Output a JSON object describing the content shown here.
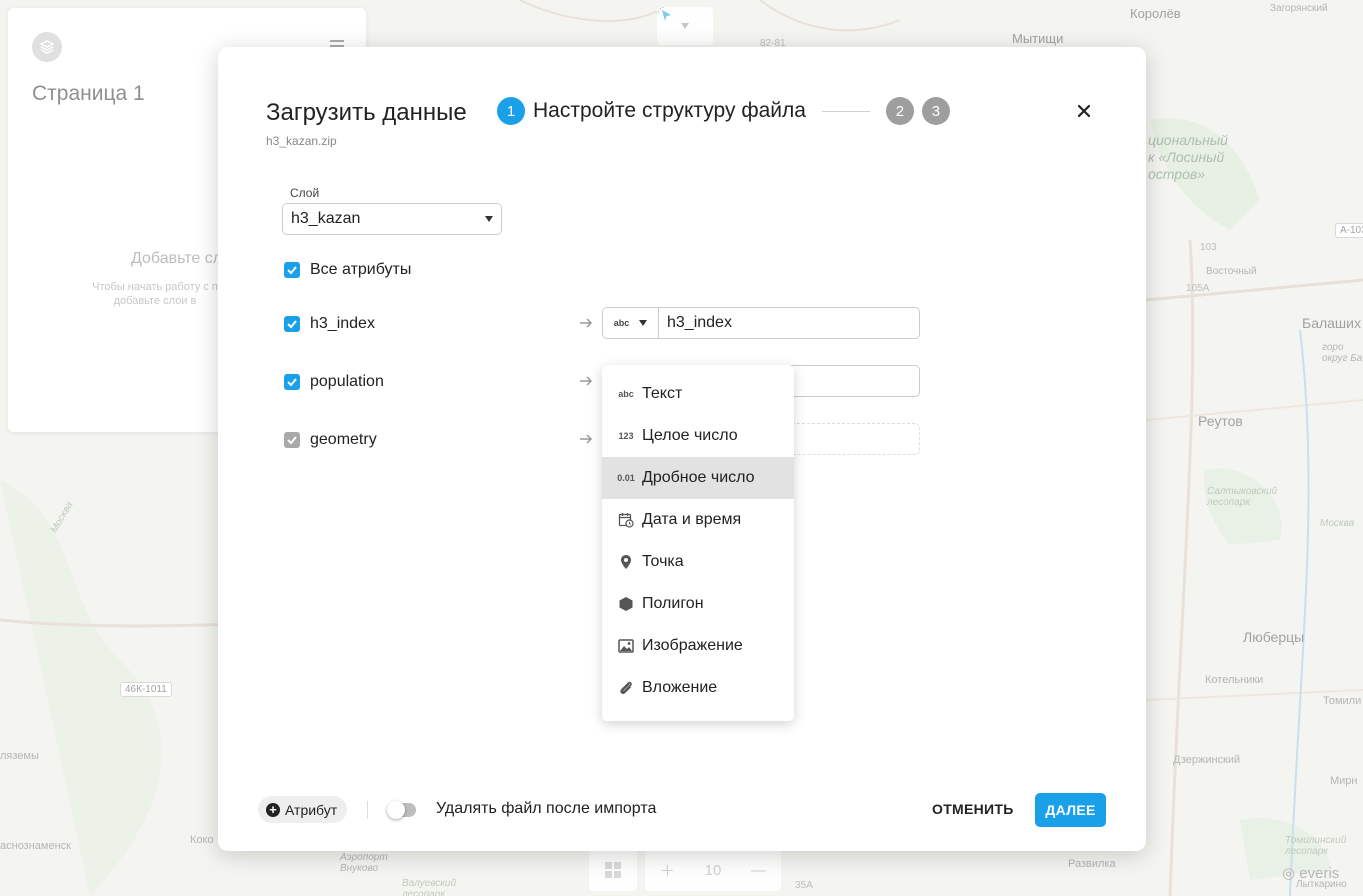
{
  "map": {
    "labels": {
      "korolev": "Королёв",
      "zagoryansky": "Загорянский",
      "mytishchi": "Мытищи",
      "natpark": "циональный\nк «Лосиный\nостров»",
      "vostochny": "Восточный",
      "balashikha": "Балаших",
      "okrug": "горо\nокруг Ба",
      "reutov": "Реутов",
      "saltykovsky": "Салтыковский\nлесопарк",
      "moskva": "Москва",
      "lyubertsy": "Люберцы",
      "kotelniki": "Котельники",
      "tomilino": "Томили",
      "dzerzhinsky": "Дзержинский",
      "mirn": "Мирн",
      "tomilinsky": "Томилинский\nлесопарк",
      "razvilka": "Развилка",
      "lytkarino": "Лыткарино",
      "vyazemy": "ляземы",
      "krasnoznamensk": "аснознаменск",
      "koko": "Коко",
      "airport": "Аэропорт\nВнуково",
      "valuevsky": "Валуевский\nлесопарк",
      "moskva_left": "Москва"
    },
    "road_badges": {
      "a103": "A-103",
      "r46k": "46К-1011"
    },
    "road_numbers": {
      "r1": "82-81",
      "r2": "103",
      "r3": "105A",
      "r4": "35A"
    },
    "zoom_value": "10",
    "brand_watermark": "everis"
  },
  "left_panel": {
    "page_title": "Страница 1",
    "empty_title": "Добавьте сл",
    "empty_text": "Чтобы начать работу с п\nдобавьте слои в"
  },
  "modal": {
    "title": "Загрузить данные",
    "file_name": "h3_kazan.zip",
    "steps": [
      {
        "number": "1",
        "label": "Настройте структуру файла"
      },
      {
        "number": "2"
      },
      {
        "number": "3"
      }
    ],
    "layer_label": "Слой",
    "layer_value": "h3_kazan",
    "all_attributes_label": "Все атрибуты",
    "attributes": [
      {
        "name": "h3_index",
        "type_icon": "abc",
        "value": "h3_index"
      },
      {
        "name": "population",
        "value": ""
      },
      {
        "name": "geometry",
        "value": ""
      }
    ],
    "type_menu": [
      {
        "icon_text": "abc",
        "icon": "text-icon",
        "label": "Текст"
      },
      {
        "icon_text": "123",
        "icon": "integer-icon",
        "label": "Целое число"
      },
      {
        "icon_text": "0.01",
        "icon": "decimal-icon",
        "label": "Дробное число",
        "highlighted": true
      },
      {
        "icon": "calendar-clock-icon",
        "label": "Дата и время"
      },
      {
        "icon": "map-pin-icon",
        "label": "Точка"
      },
      {
        "icon": "hexagon-icon",
        "label": "Полигон"
      },
      {
        "icon": "image-icon",
        "label": "Изображение"
      },
      {
        "icon": "paperclip-icon",
        "label": "Вложение"
      }
    ],
    "footer": {
      "add_attribute_label": "Атрибут",
      "delete_toggle_label": "Удалять файл после импорта",
      "delete_toggle_on": false,
      "cancel_label": "ОТМЕНИТЬ",
      "next_label": "ДАЛЕЕ"
    },
    "accent_color": "#1aa0e8"
  }
}
